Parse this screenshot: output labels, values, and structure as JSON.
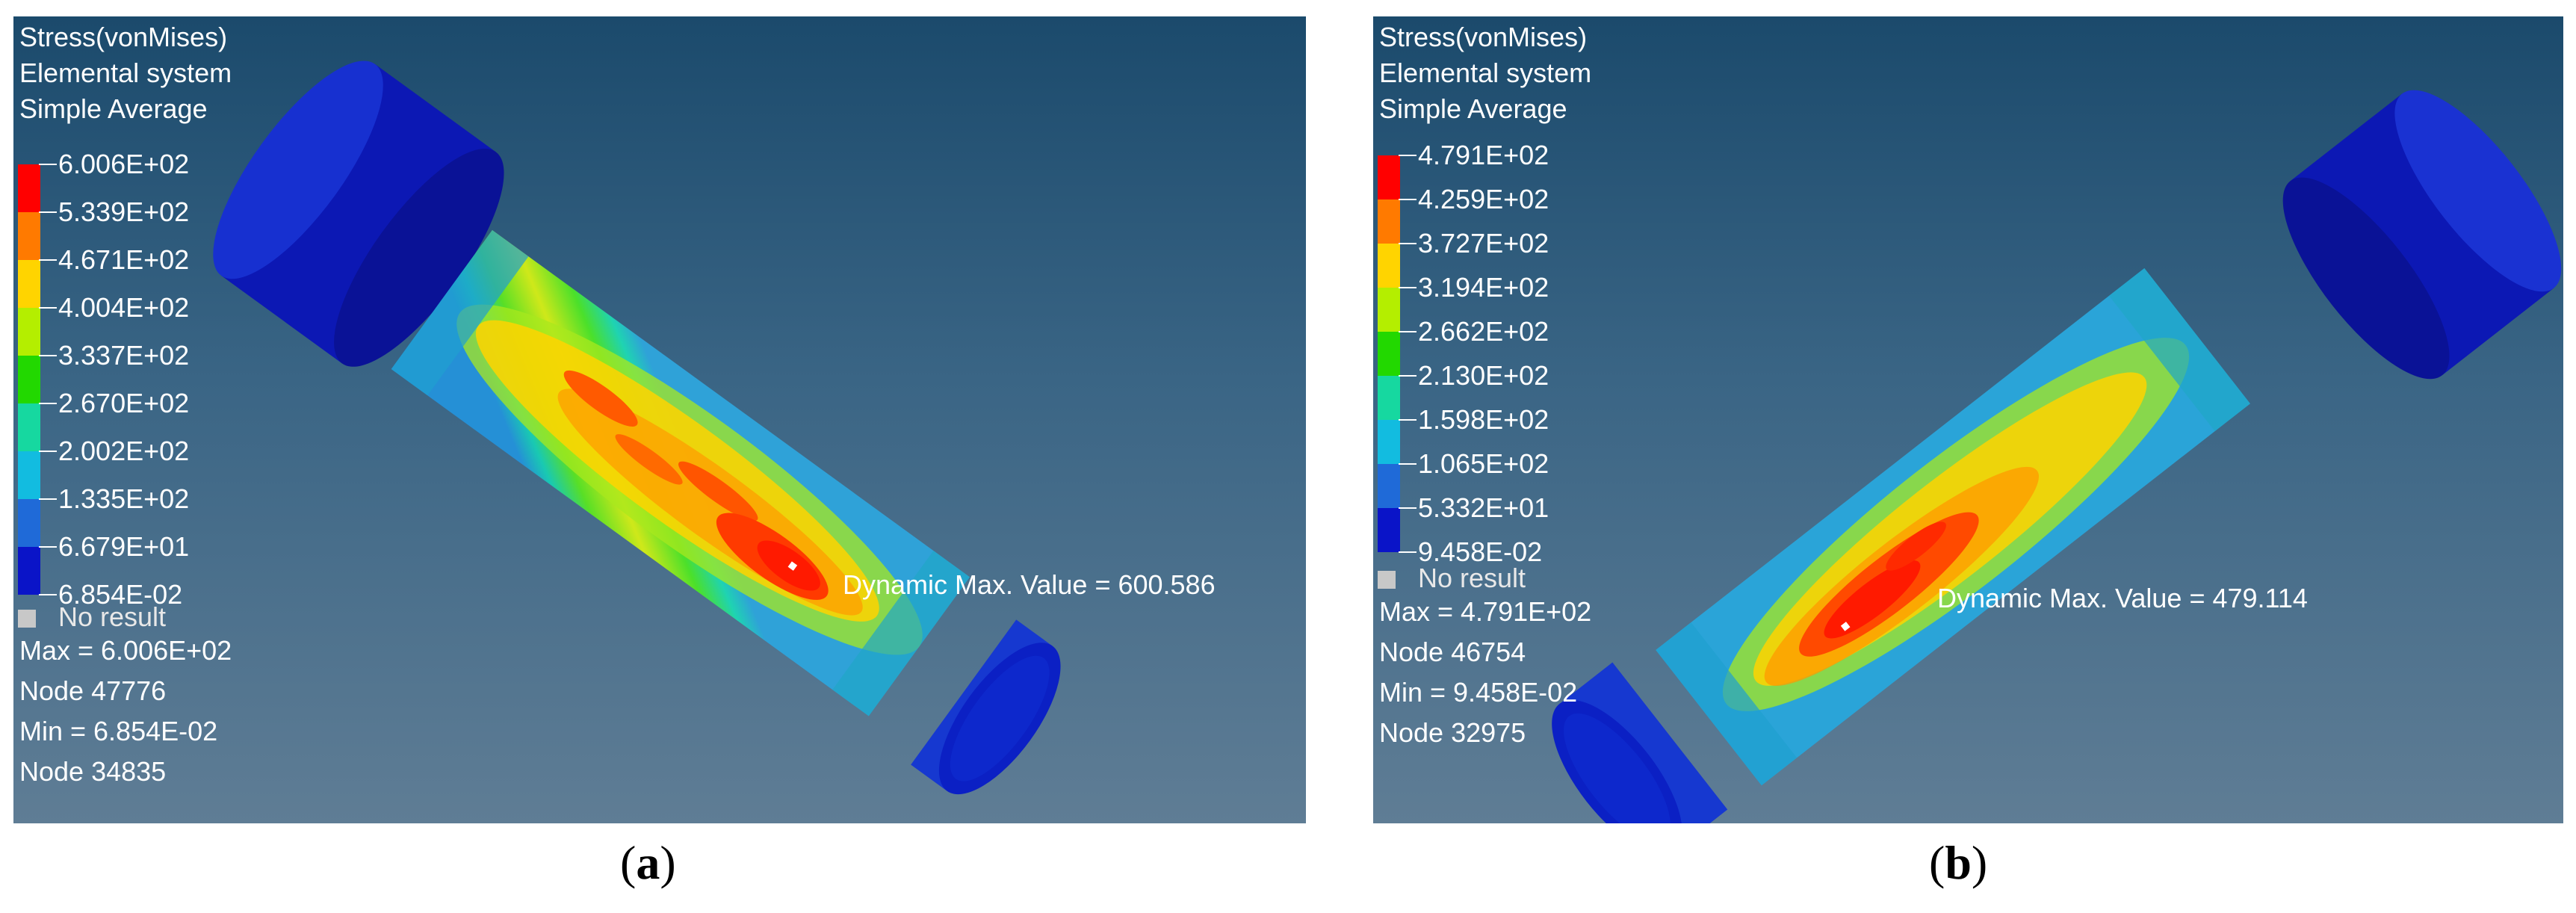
{
  "panels": [
    {
      "id": "a",
      "header": [
        "Stress(vonMises)",
        "Elemental system",
        "Simple Average"
      ],
      "legend": {
        "colors": [
          "#ff0000",
          "#ff7a00",
          "#ffd400",
          "#b4ee00",
          "#22d800",
          "#16d8a0",
          "#12bce0",
          "#1f6ad8",
          "#0a14c8"
        ],
        "ticks": [
          "6.006E+02",
          "5.339E+02",
          "4.671E+02",
          "4.004E+02",
          "3.337E+02",
          "2.670E+02",
          "2.002E+02",
          "1.335E+02",
          "6.679E+01",
          "6.854E-02"
        ]
      },
      "no_result": "No result",
      "info": [
        "Max = 6.006E+02",
        "Node 47776",
        "Min = 6.854E-02",
        "Node 34835"
      ],
      "dynamic_max": "Dynamic Max. Value =  600.586",
      "caption_letter": "a"
    },
    {
      "id": "b",
      "header": [
        "Stress(vonMises)",
        "Elemental system",
        "Simple Average"
      ],
      "legend": {
        "colors": [
          "#ff0000",
          "#ff7a00",
          "#ffd400",
          "#b4ee00",
          "#22d800",
          "#16d8a0",
          "#12bce0",
          "#1f6ad8",
          "#0a14c8"
        ],
        "ticks": [
          "4.791E+02",
          "4.259E+02",
          "3.727E+02",
          "3.194E+02",
          "2.662E+02",
          "2.130E+02",
          "1.598E+02",
          "1.065E+02",
          "5.332E+01",
          "9.458E-02"
        ]
      },
      "no_result": "No result",
      "info": [
        "Max = 4.791E+02",
        "Node 46754",
        "Min = 9.458E-02",
        "Node 32975"
      ],
      "dynamic_max": "Dynamic Max. Value =  479.114",
      "caption_letter": "b"
    }
  ]
}
